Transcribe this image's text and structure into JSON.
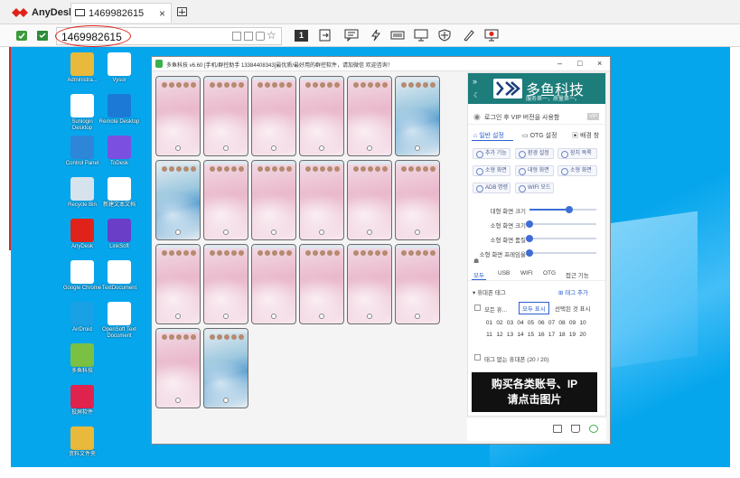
{
  "app": {
    "name": "AnyDesk",
    "tab_label": "1469982615"
  },
  "address": {
    "value": "1469982615"
  },
  "toolbar": {
    "screen_number": "1"
  },
  "desktop_icons": [
    {
      "label": "Administra...",
      "color": "#e8b93a"
    },
    {
      "label": "Vysor",
      "color": "#ffffff"
    },
    {
      "label": "Sunlogin Desktop",
      "color": "#ffffff"
    },
    {
      "label": "Remote Desktop",
      "color": "#1d79d6"
    },
    {
      "label": "Control Panel",
      "color": "#2e86d9"
    },
    {
      "label": "ToDesk",
      "color": "#7b4fe0"
    },
    {
      "label": "Recycle Bin",
      "color": "#d7e3ec"
    },
    {
      "label": "新建文本文档",
      "color": "#ffffff"
    },
    {
      "label": "AnyDesk",
      "color": "#e0231a"
    },
    {
      "label": "LinkSoft",
      "color": "#6a3ec6"
    },
    {
      "label": "Google Chrome",
      "color": "#ffffff"
    },
    {
      "label": "TextDocument",
      "color": "#ffffff"
    },
    {
      "label": "AirDroid",
      "color": "#19a0e5"
    },
    {
      "label": "OpenSoft Text Document",
      "color": "#ffffff"
    },
    {
      "label": "多鱼科技",
      "color": "#7ac143"
    },
    {
      "label": "投屏软件",
      "color": "#e0234d"
    },
    {
      "label": "资料文件夹",
      "color": "#e8b93a"
    }
  ],
  "tool_window": {
    "title": "多鱼科技 v6.60 [手机/群控助手 13384408343]最优质/最好用的群控软件，请加微信 欢迎咨询！",
    "controls": {
      "minimize": "–",
      "maximize": "□",
      "close": "×"
    }
  },
  "panel": {
    "brand_name": "多鱼科技",
    "brand_slogan": "服务第一，质量第一。",
    "login_text": "로그인 후 VIP 버전을 사용함",
    "login_badge": "VIP",
    "tabs": [
      "일반 설정",
      "OTG 설정",
      "배경 창"
    ],
    "buttons_row1": [
      "추가 기능",
      "환경 설정",
      "장치 목록"
    ],
    "buttons_row2": [
      "소형 화면",
      "대형 화면",
      "소형 화면"
    ],
    "buttons_row3": [
      "ADB 명령",
      "WIFI 모드"
    ],
    "sliders": [
      {
        "label": "대형 화면 크기",
        "value": 0.6
      },
      {
        "label": "소형 화면 크기",
        "value": 0.0
      },
      {
        "label": "소형 화면 품질",
        "value": 0.0
      },
      {
        "label": "소형 화면 프레임율",
        "value": 0.0
      }
    ],
    "mode_tabs": [
      "모두",
      "USB",
      "WIFI",
      "OTG",
      "접근 기능"
    ],
    "group_title": "휴대폰 태그",
    "add_tag": "태그 추가",
    "select_all": "모든 휴...",
    "show_all": "모두 표시",
    "show_selected": "선택된 것 표시",
    "device_numbers": [
      "01",
      "02",
      "03",
      "04",
      "05",
      "06",
      "07",
      "08",
      "09",
      "10",
      "11",
      "12",
      "13",
      "14",
      "15",
      "16",
      "17",
      "18",
      "19",
      "20"
    ],
    "no_tag_label": "태그 없는 휴대폰 (20 / 20)",
    "promo_line1": "购买各类账号、IP",
    "promo_line2": "请点击图片"
  },
  "phones": {
    "count": 20,
    "blue_indices": [
      5,
      6,
      19
    ]
  }
}
